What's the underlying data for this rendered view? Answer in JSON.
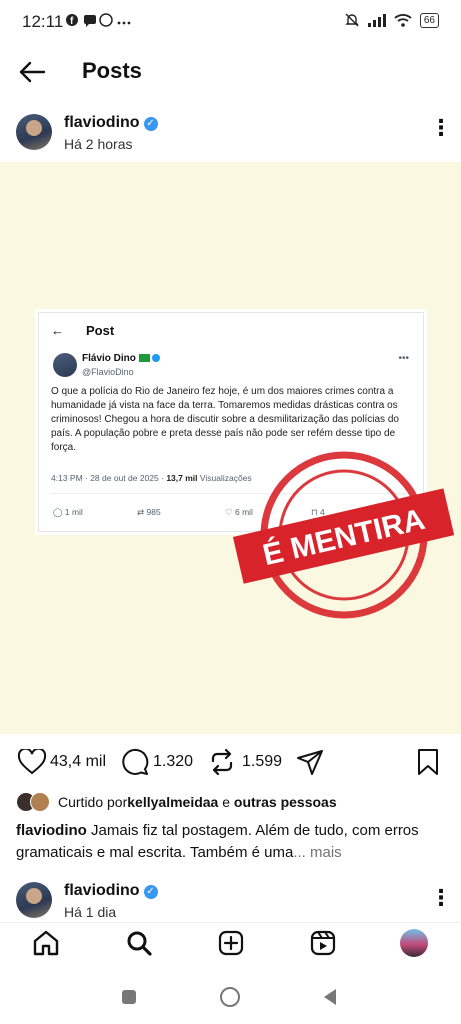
{
  "status_bar": {
    "time": "12:11",
    "battery": "66"
  },
  "header": {
    "title": "Posts"
  },
  "post": {
    "username": "flaviodino",
    "time_ago": "Há 2 horas",
    "embedded_tweet": {
      "header_title": "Post",
      "name": "Flávio Dino",
      "handle": "@FlavioDino",
      "text": "O que a polícia do Rio de Janeiro fez hoje, é um dos maiores crimes contra a humanidade já vista na face da terra. Tomaremos medidas drásticas contra os criminosos! Chegou a hora de discutir sobre a desmilitarização das polícias do país. A população pobre e preta desse país não pode ser refém desse tipo de força.",
      "timestamp": "4:13 PM · 28 de out de 2025 · ",
      "views": "13,7 mil",
      "views_label": " Visualizações",
      "replies": "1 mil",
      "retweets": "985",
      "likes": "6 mil",
      "bookmarks": "4"
    },
    "stamp_text": "É MENTIRA",
    "likes": "43,4 mil",
    "comments": "1.320",
    "reposts": "1.599",
    "liked_by_prefix": "Curtido por ",
    "liked_by_user": "kellyalmeidaa",
    "liked_by_and": " e ",
    "liked_by_others": "outras pessoas",
    "caption_user": "flaviodino",
    "caption_text": " Jamais fiz tal postagem. Além de tudo, com erros gramaticais e mal escrita. Também é uma",
    "caption_more": "... mais"
  },
  "next_post": {
    "username": "flaviodino",
    "time_ago": "Há 1 dia"
  },
  "colors": {
    "verified": "#3897f0",
    "stamp_red": "#d8232a",
    "image_bg": "#fbf8e2"
  }
}
